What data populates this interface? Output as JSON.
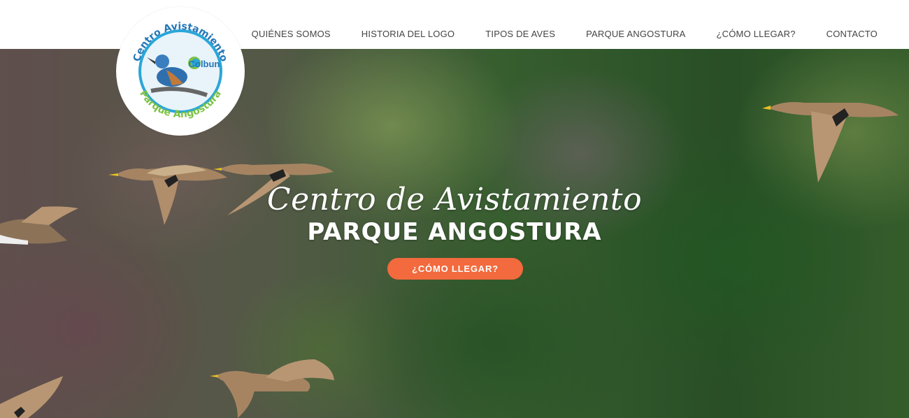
{
  "nav": {
    "items": [
      {
        "label": "QUIÉNES SOMOS"
      },
      {
        "label": "HISTORIA DEL LOGO"
      },
      {
        "label": "TIPOS DE AVES"
      },
      {
        "label": "PARQUE ANGOSTURA"
      },
      {
        "label": "¿CÓMO LLEGAR?"
      },
      {
        "label": "CONTACTO"
      }
    ]
  },
  "logo": {
    "top_text": "Centro Avistamiento",
    "bottom_text": "Parque Angostura",
    "brand": "Colbun",
    "colors": {
      "ring": "#2aa6d8",
      "green": "#7cc242",
      "blue": "#2577b8"
    }
  },
  "hero": {
    "script_title": "Centro de Avistamiento",
    "title": "PARQUE ANGOSTURA",
    "cta_label": "¿CÓMO LLEGAR?",
    "cta_color": "#f26a3d"
  }
}
